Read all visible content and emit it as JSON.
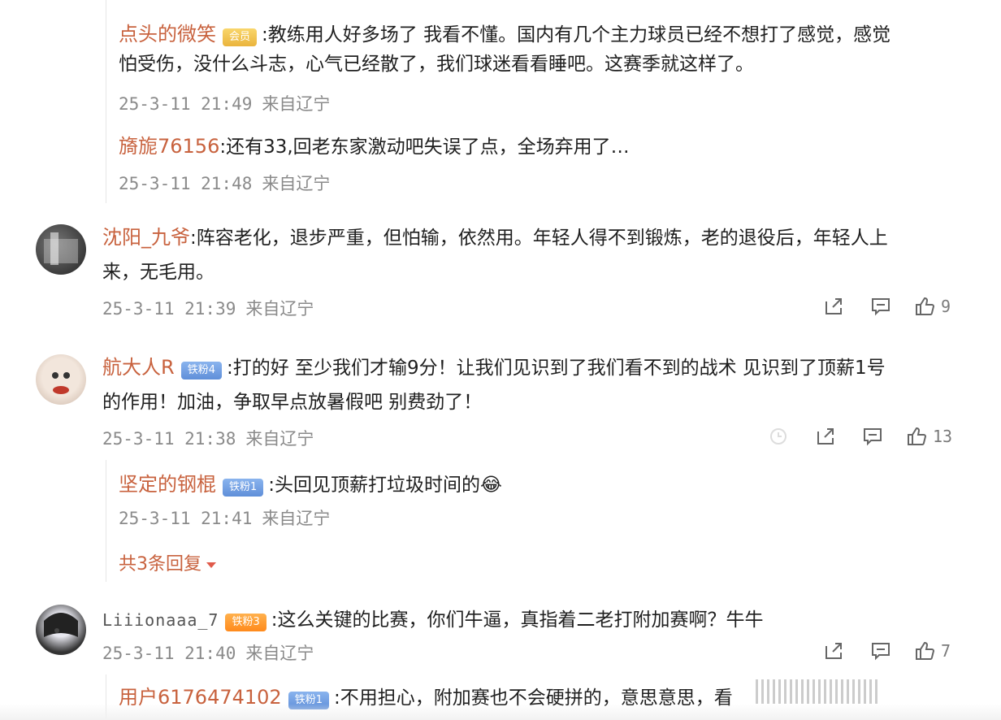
{
  "thread_top": [
    {
      "name": "点头的微笑",
      "badge": "会员",
      "text_line1": ":教练用人好多场了 我看不懂。国内有几个主力球员已经不想打了感觉，感觉",
      "text_line2": "怕受伤，没什么斗志，心气已经散了，我们球迷看看睡吧。这赛季就这样了。",
      "time": "25-3-11 21:49",
      "source": "来自辽宁"
    },
    {
      "name": "旖旎76156",
      "text": ":还有33,回老东家激动吧失误了点，全场弃用了…",
      "time": "25-3-11 21:48",
      "source": "来自辽宁"
    }
  ],
  "comments": [
    {
      "name": "沈阳_九爷",
      "text_line1": ":阵容老化，退步严重，但怕输，依然用。年轻人得不到锻炼，老的退役后，年轻人上",
      "text_line2": "来，无毛用。",
      "time": "25-3-11 21:39",
      "source": "来自辽宁",
      "likes": "9"
    },
    {
      "name": "航大人R",
      "badge": "铁粉4",
      "text_line1": ":打的好   至少我们才输9分！让我们见识到了我们看不到的战术 见识到了顶薪1号",
      "text_line2": "的作用！加油，争取早点放暑假吧 别费劲了！",
      "time": "25-3-11 21:38",
      "source": "来自辽宁",
      "likes": "13",
      "reply": {
        "name": "坚定的钢棍",
        "badge": "铁粉1",
        "text": ":头回见顶薪打垃圾时间的",
        "emoji": "😂",
        "time": "25-3-11 21:41",
        "source": "来自辽宁"
      },
      "more_replies": "共3条回复"
    },
    {
      "name": "Liiionaaa_7",
      "badge": "铁粉3",
      "text": ":这么关键的比赛，你们牛逼，真指着二老打附加赛啊？牛牛",
      "time": "25-3-11 21:40",
      "source": "来自辽宁",
      "likes": "7",
      "reply": {
        "name": "用户6176474102",
        "badge": "铁粉1",
        "text": ":不用担心，附加赛也不会硬拼的，意思意思，看"
      }
    }
  ],
  "icons": {
    "share": "share-icon",
    "comment": "comment-icon",
    "like": "thumbs-up-icon"
  }
}
